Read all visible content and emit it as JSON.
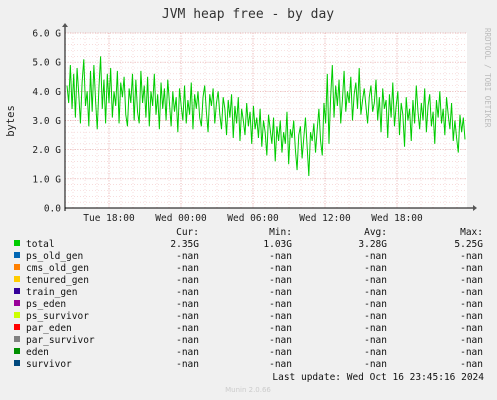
{
  "chart_data": {
    "type": "line",
    "title": "JVM heap free - by day",
    "ylabel": "bytes",
    "side_label": "RRDTOOL / TOBI OETIKER",
    "ylim": [
      0,
      6.0
    ],
    "y_ticks": [
      "0.0",
      "1.0 G",
      "2.0 G",
      "3.0 G",
      "4.0 G",
      "5.0 G",
      "6.0 G"
    ],
    "x_ticks": [
      "Tue 18:00",
      "Wed 00:00",
      "Wed 06:00",
      "Wed 12:00",
      "Wed 18:00"
    ],
    "grid": true,
    "series": [
      {
        "name": "total",
        "color": "#00cc00",
        "values": [
          4.2,
          3.6,
          4.9,
          3.4,
          4.6,
          3.1,
          4.8,
          3.9,
          2.9,
          4.3,
          5.1,
          3.5,
          4.0,
          2.8,
          4.7,
          3.3,
          4.9,
          3.7,
          2.7,
          4.1,
          5.2,
          3.4,
          4.4,
          2.9,
          4.6,
          3.6,
          4.8,
          3.1,
          4.0,
          3.5,
          4.7,
          2.9,
          4.3,
          3.8,
          4.5,
          3.2,
          2.8,
          4.1,
          3.6,
          4.6,
          3.0,
          4.4,
          3.3,
          2.9,
          4.7,
          3.6,
          4.2,
          3.1,
          4.5,
          2.8,
          4.0,
          3.5,
          4.6,
          3.2,
          3.9,
          2.7,
          4.3,
          3.4,
          4.1,
          3.0,
          4.4,
          3.6,
          2.8,
          4.0,
          3.3,
          3.8,
          2.6,
          4.1,
          3.5,
          3.0,
          4.2,
          2.9,
          3.7,
          3.2,
          4.3,
          2.7,
          3.9,
          3.4,
          4.0,
          3.1,
          2.8,
          3.8,
          4.2,
          3.3,
          2.6,
          3.9,
          3.5,
          4.1,
          2.9,
          3.6,
          4.0,
          3.2,
          2.7,
          3.8,
          3.4,
          2.5,
          3.7,
          3.1,
          3.9,
          2.4,
          3.5,
          2.9,
          3.8,
          2.3,
          3.4,
          3.0,
          2.5,
          3.6,
          2.8,
          3.3,
          2.2,
          3.5,
          2.7,
          3.1,
          2.4,
          3.4,
          2.1,
          3.0,
          2.6,
          1.8,
          3.2,
          2.7,
          2.2,
          3.1,
          1.6,
          2.8,
          2.3,
          3.0,
          1.9,
          2.6,
          2.2,
          3.3,
          1.5,
          2.7,
          2.4,
          3.0,
          2.0,
          1.3,
          2.5,
          2.8,
          1.7,
          2.4,
          3.1,
          2.1,
          1.1,
          2.6,
          2.3,
          2.9,
          1.9,
          2.7,
          3.4,
          2.3,
          1.8,
          3.6,
          2.9,
          4.6,
          2.2,
          3.8,
          4.9,
          3.1,
          4.2,
          3.5,
          4.4,
          2.9,
          3.7,
          4.7,
          3.3,
          4.0,
          3.6,
          4.5,
          3.0,
          3.9,
          4.3,
          3.4,
          4.8,
          3.2,
          3.7,
          4.1,
          3.5,
          2.9,
          3.8,
          4.2,
          3.3,
          3.6,
          4.4,
          3.0,
          3.8,
          2.6,
          4.1,
          3.4,
          3.7,
          2.4,
          3.9,
          3.1,
          4.3,
          2.8,
          3.5,
          4.0,
          2.5,
          3.6,
          3.2,
          2.1,
          3.8,
          3.0,
          3.4,
          2.3,
          3.7,
          2.9,
          4.2,
          3.3,
          2.7,
          3.6,
          3.0,
          4.1,
          2.6,
          3.5,
          3.9,
          2.8,
          3.3,
          2.2,
          3.7,
          3.1,
          4.0,
          2.9,
          3.4,
          2.5,
          3.8,
          3.2,
          2.7,
          3.6,
          2.3,
          3.0,
          2.4,
          1.9,
          3.2,
          2.6,
          3.1,
          2.35
        ]
      },
      {
        "name": "ps_old_gen",
        "color": "#0066b3",
        "values": []
      },
      {
        "name": "cms_old_gen",
        "color": "#ff8000",
        "values": []
      },
      {
        "name": "tenured_gen",
        "color": "#ffcc00",
        "values": []
      },
      {
        "name": "train_gen",
        "color": "#330099",
        "values": []
      },
      {
        "name": "ps_eden",
        "color": "#990099",
        "values": []
      },
      {
        "name": "ps_survivor",
        "color": "#ccff00",
        "values": []
      },
      {
        "name": "par_eden",
        "color": "#ff0000",
        "values": []
      },
      {
        "name": "par_survivor",
        "color": "#808080",
        "values": []
      },
      {
        "name": "eden",
        "color": "#008f00",
        "values": []
      },
      {
        "name": "survivor",
        "color": "#00487d",
        "values": []
      }
    ]
  },
  "legend": {
    "headers": {
      "cur": "Cur:",
      "min": "Min:",
      "avg": "Avg:",
      "max": "Max:"
    },
    "rows": [
      {
        "name": "total",
        "color": "#00cc00",
        "cur": "2.35G",
        "min": "1.03G",
        "avg": "3.28G",
        "max": "5.25G"
      },
      {
        "name": "ps_old_gen",
        "color": "#0066b3",
        "cur": "-nan",
        "min": "-nan",
        "avg": "-nan",
        "max": "-nan"
      },
      {
        "name": "cms_old_gen",
        "color": "#ff8000",
        "cur": "-nan",
        "min": "-nan",
        "avg": "-nan",
        "max": "-nan"
      },
      {
        "name": "tenured_gen",
        "color": "#ffcc00",
        "cur": "-nan",
        "min": "-nan",
        "avg": "-nan",
        "max": "-nan"
      },
      {
        "name": "train_gen",
        "color": "#330099",
        "cur": "-nan",
        "min": "-nan",
        "avg": "-nan",
        "max": "-nan"
      },
      {
        "name": "ps_eden",
        "color": "#990099",
        "cur": "-nan",
        "min": "-nan",
        "avg": "-nan",
        "max": "-nan"
      },
      {
        "name": "ps_survivor",
        "color": "#ccff00",
        "cur": "-nan",
        "min": "-nan",
        "avg": "-nan",
        "max": "-nan"
      },
      {
        "name": "par_eden",
        "color": "#ff0000",
        "cur": "-nan",
        "min": "-nan",
        "avg": "-nan",
        "max": "-nan"
      },
      {
        "name": "par_survivor",
        "color": "#808080",
        "cur": "-nan",
        "min": "-nan",
        "avg": "-nan",
        "max": "-nan"
      },
      {
        "name": "eden",
        "color": "#008f00",
        "cur": "-nan",
        "min": "-nan",
        "avg": "-nan",
        "max": "-nan"
      },
      {
        "name": "survivor",
        "color": "#00487d",
        "cur": "-nan",
        "min": "-nan",
        "avg": "-nan",
        "max": "-nan"
      }
    ]
  },
  "footer": {
    "last_update": "Last update: Wed Oct 16 23:45:16 2024",
    "munin_version": "Munin 2.0.66"
  }
}
